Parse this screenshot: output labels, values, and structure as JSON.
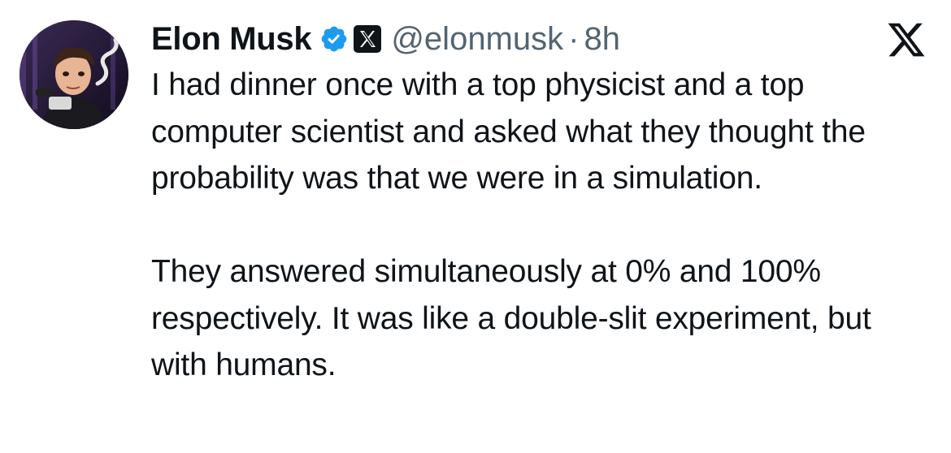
{
  "tweet": {
    "author_name": "Elon Musk",
    "handle": "@elonmusk",
    "separator": "·",
    "time": "8h",
    "paragraphs": [
      "I had dinner once with a top physicist and a top computer scientist and asked what they thought the probability was that we were in a simulation.",
      "They answered simultaneously at 0% and 100% respectively. It was like a double-slit experiment, but with humans."
    ]
  },
  "icons": {
    "avatar": "avatar-image",
    "verified": "verified-badge-icon",
    "affiliate": "x-affiliate-badge-icon",
    "platform": "x-logo-icon"
  },
  "colors": {
    "text": "#0f1419",
    "secondary": "#536471",
    "verified_blue": "#1d9bf0",
    "background": "#ffffff"
  }
}
